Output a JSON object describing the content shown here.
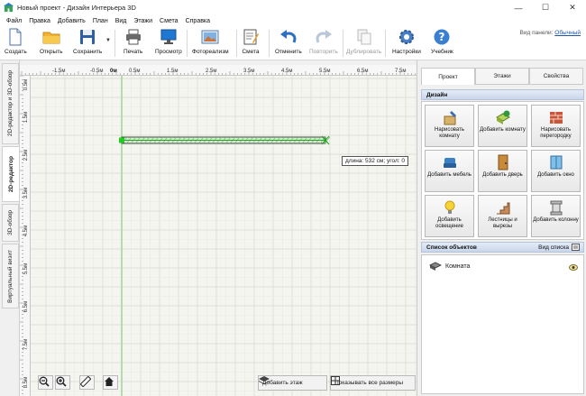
{
  "window": {
    "title": "Новый проект - Дизайн Интерьера 3D",
    "minimize": "—",
    "maximize": "☐",
    "close": "✕"
  },
  "menu": [
    "Файл",
    "Правка",
    "Добавить",
    "План",
    "Вид",
    "Этажи",
    "Смета",
    "Справка"
  ],
  "toolbar": {
    "create": "Создать",
    "open": "Открыть",
    "save": "Сохранить",
    "print": "Печать",
    "preview": "Просмотр",
    "photoreal": "Фотореализм",
    "estimate": "Смета",
    "undo": "Отменить",
    "redo": "Повторить",
    "duplicate": "Дублировать",
    "settings": "Настройки",
    "tutorial": "Учебник",
    "panel_view_label": "Вид панели:",
    "panel_view_value": "Обычный"
  },
  "view_tabs": [
    "2D-редактор и 3D-обзор",
    "2D-редактор",
    "3D-обзор",
    "Виртуальный визит"
  ],
  "ruler": {
    "top": [
      "-1.5м",
      "-0.5м",
      "0м",
      "0.5м",
      "1.5м",
      "2.5м",
      "3.5м",
      "4.5м",
      "5.5м",
      "6.5м",
      "7.5м"
    ],
    "left": [
      "0.5м",
      "1.5м",
      "2.5м",
      "3.5м",
      "4.5м",
      "5.5м",
      "6.5м",
      "7.5м",
      "8.5м"
    ]
  },
  "canvas": {
    "tooltip": "длина: 532 см; угол: 0"
  },
  "bottom": {
    "add_floor": "Добавить этаж",
    "show_sizes": "Показывать все размеры"
  },
  "right_panel": {
    "tabs": [
      "Проект",
      "Этажи",
      "Свойства"
    ],
    "design_header": "Дизайн",
    "buttons": [
      "Нарисовать комнату",
      "Добавить комнату",
      "Нарисовать перегородку",
      "Добавить мебель",
      "Добавить дверь",
      "Добавить окно",
      "Добавить освещение",
      "Лестницы и вырезы",
      "Добавить колонну"
    ],
    "objects_header": "Список объектов",
    "view_list": "Вид списка",
    "objects": [
      "Комната"
    ]
  },
  "colors": {
    "accent": "#3b6fb6",
    "wall_green": "#22aa22",
    "grid": "#dcdcd4"
  }
}
